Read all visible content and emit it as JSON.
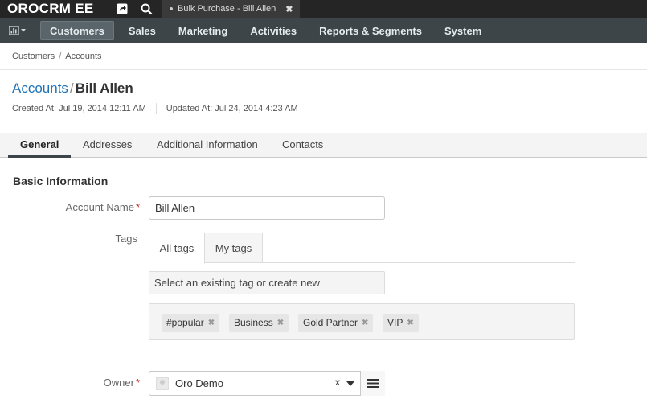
{
  "app": {
    "logo": "OROCRM EE"
  },
  "topbar": {
    "open_tab": {
      "label": "Bulk Purchase - Bill Allen",
      "close_glyph": "✖"
    }
  },
  "menu": {
    "items": [
      {
        "label": "Customers",
        "active": true
      },
      {
        "label": "Sales"
      },
      {
        "label": "Marketing"
      },
      {
        "label": "Activities"
      },
      {
        "label": "Reports & Segments"
      },
      {
        "label": "System"
      }
    ]
  },
  "breadcrumb": {
    "items": [
      "Customers",
      "Accounts"
    ],
    "separator": "/"
  },
  "page": {
    "parent": "Accounts",
    "separator": "/",
    "title": "Bill Allen",
    "created": "Created At: Jul 19, 2014 12:11 AM",
    "updated": "Updated At: Jul 24, 2014 4:23 AM"
  },
  "tabs": [
    "General",
    "Addresses",
    "Additional Information",
    "Contacts"
  ],
  "form": {
    "section_title": "Basic Information",
    "account_name_label": "Account Name",
    "account_name_value": "Bill Allen",
    "required_mark": "*",
    "tags_label": "Tags",
    "tag_tabs": [
      "All tags",
      "My tags"
    ],
    "tag_input_placeholder": "Select an existing tag or create new",
    "tags": [
      "#popular",
      "Business",
      "Gold Partner",
      "VIP"
    ],
    "tag_remove_glyph": "✖",
    "owner_label": "Owner",
    "owner_value": "Oro Demo",
    "owner_clear_glyph": "x"
  }
}
